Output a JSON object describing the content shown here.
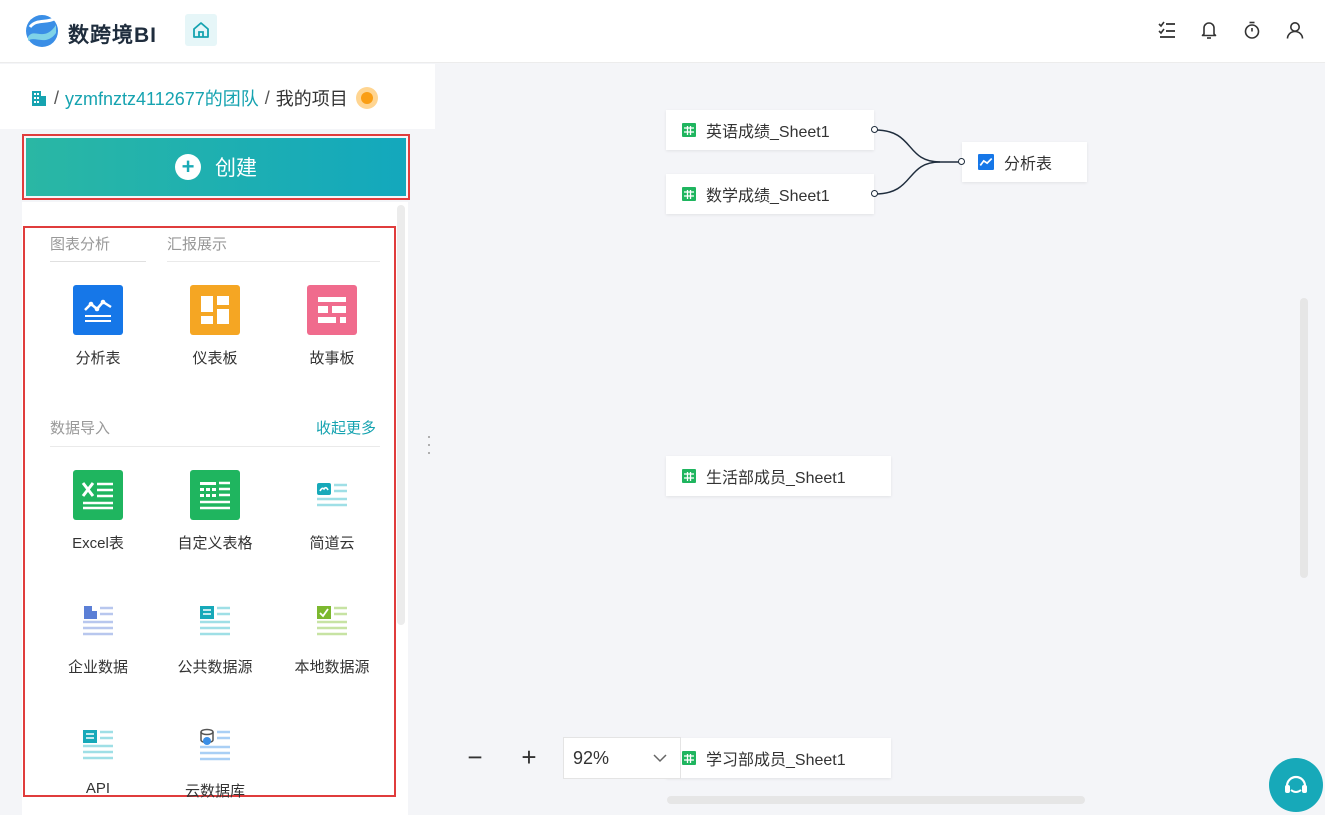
{
  "app": {
    "brand": "数跨境BI"
  },
  "topbar": {
    "icons": [
      "home-icon",
      "task-list-icon",
      "bell-icon",
      "timer-icon",
      "user-icon"
    ]
  },
  "breadcrumb": {
    "team": "yzmfnztz4112677的团队",
    "project": "我的项目",
    "separator": "/"
  },
  "create_button": {
    "label": "创建",
    "icon": "plus-circle-icon"
  },
  "menu": {
    "tabs": [
      {
        "label": "图表分析"
      },
      {
        "label": "汇报展示"
      }
    ],
    "analysis_items": [
      {
        "label": "分析表",
        "icon": "analysis-table-icon",
        "color": "#1677e8"
      },
      {
        "label": "仪表板",
        "icon": "dashboard-icon",
        "color": "#f5a623"
      },
      {
        "label": "故事板",
        "icon": "storyboard-icon",
        "color": "#f06b8d"
      }
    ],
    "import_title": "数据导入",
    "collapse_label": "收起更多",
    "import_items": [
      {
        "label": "Excel表",
        "icon": "excel-icon",
        "color": "#1fb55f"
      },
      {
        "label": "自定义表格",
        "icon": "custom-table-icon",
        "color": "#1fb55f"
      },
      {
        "label": "简道云",
        "icon": "jiandaoyun-icon",
        "color": "#17a9b9"
      },
      {
        "label": "企业数据",
        "icon": "enterprise-data-icon",
        "color": "#5b7fd6"
      },
      {
        "label": "公共数据源",
        "icon": "public-datasource-icon",
        "color": "#17a9b9"
      },
      {
        "label": "本地数据源",
        "icon": "local-datasource-icon",
        "color": "#7cb82f"
      },
      {
        "label": "API",
        "icon": "api-icon",
        "color": "#17a9b9"
      },
      {
        "label": "云数据库",
        "icon": "cloud-database-icon",
        "color": "#3a8ee6"
      }
    ]
  },
  "canvas": {
    "nodes": [
      {
        "label": "英语成绩_Sheet1",
        "icon": "sheet-icon"
      },
      {
        "label": "数学成绩_Sheet1",
        "icon": "sheet-icon"
      },
      {
        "label": "分析表",
        "icon": "analysis-table-icon"
      },
      {
        "label": "生活部成员_Sheet1",
        "icon": "sheet-icon"
      },
      {
        "label": "学习部成员_Sheet1",
        "icon": "sheet-icon"
      }
    ],
    "zoom": {
      "minus": "−",
      "plus": "+",
      "value": "92%"
    }
  },
  "colors": {
    "accent": "#16a3b0",
    "highlight_border": "#e03c3c",
    "sheet_green": "#1fb55f",
    "analysis_blue": "#1677e8"
  }
}
